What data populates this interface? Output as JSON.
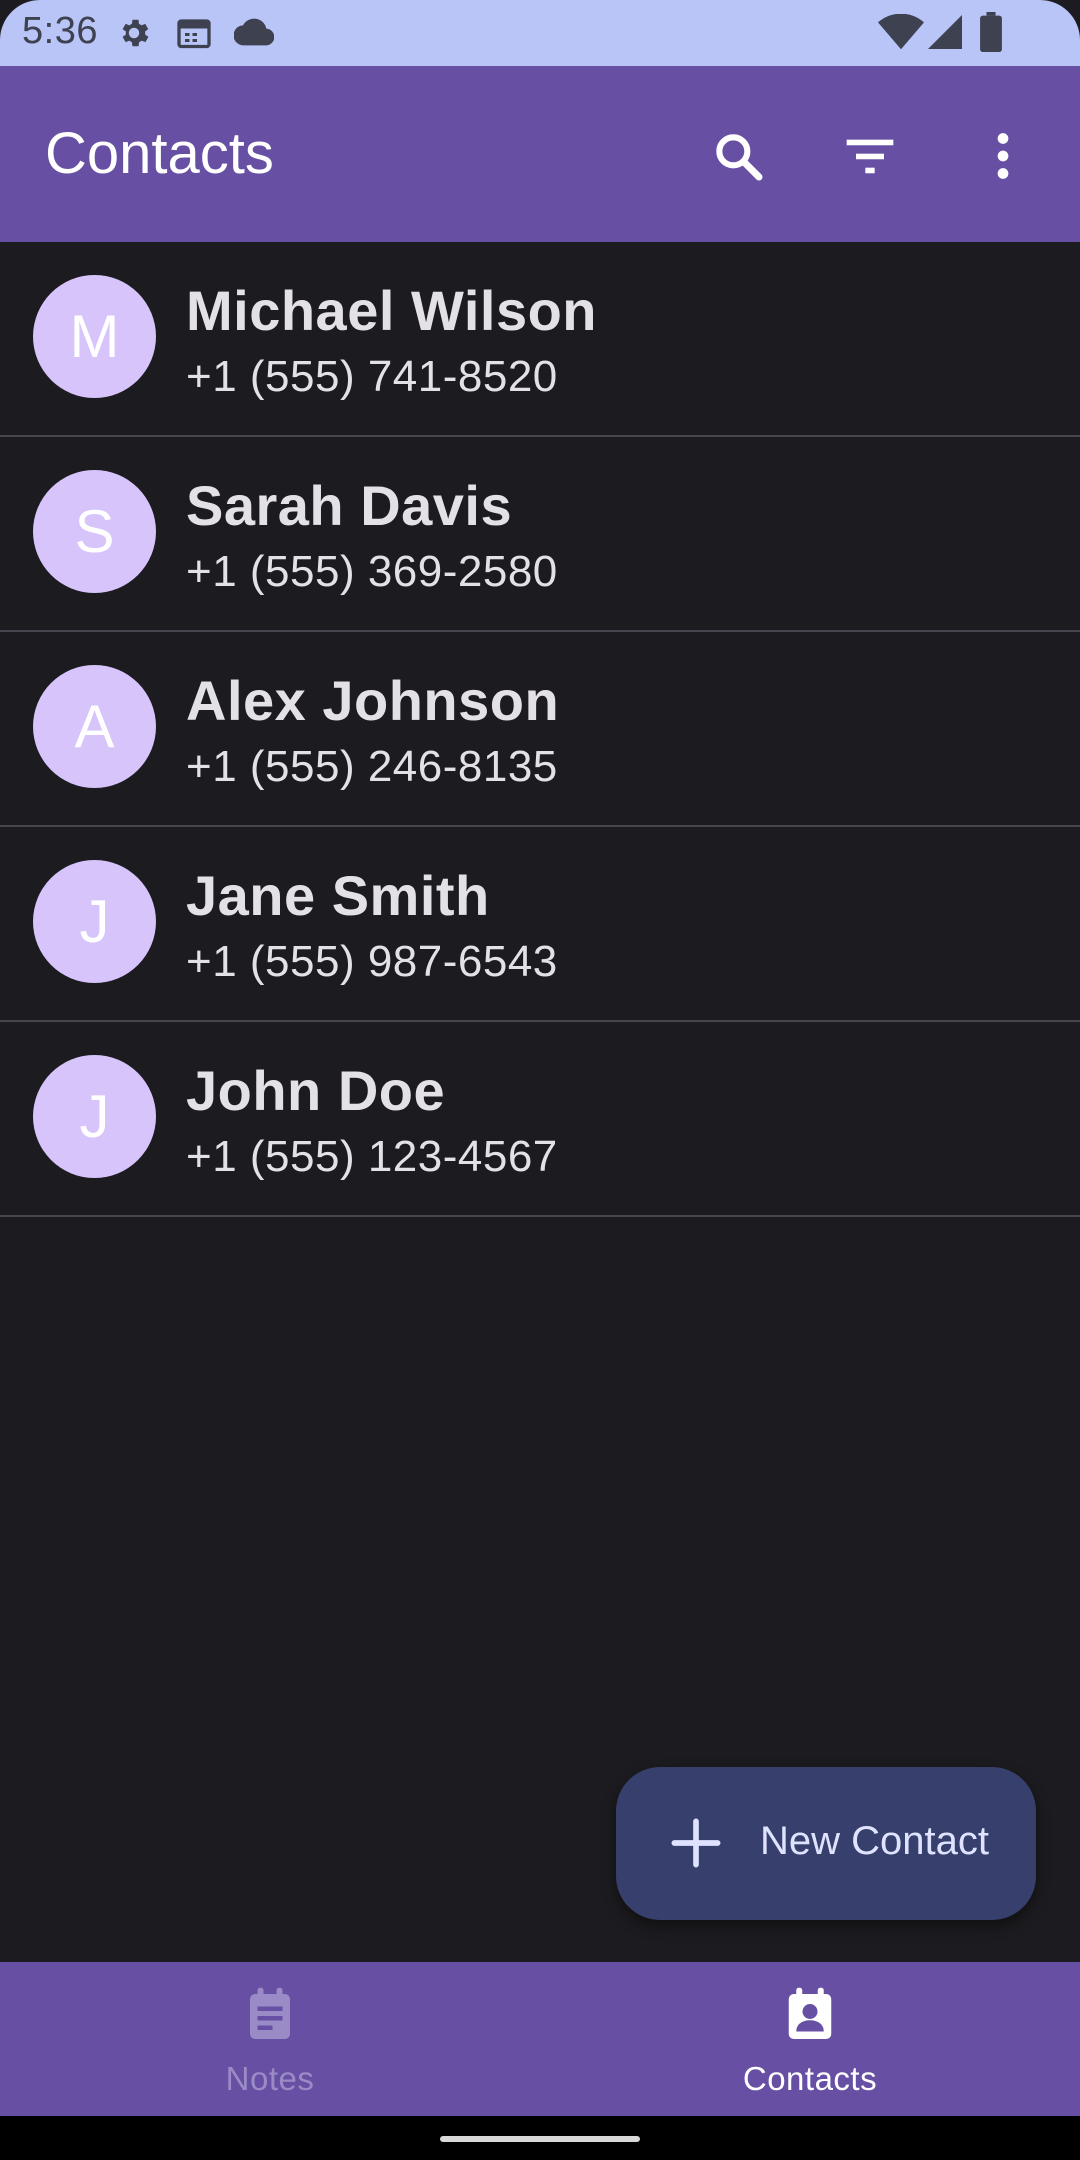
{
  "status_bar": {
    "time": "5:36",
    "left_icons": [
      "gear-icon",
      "calendar-icon",
      "cloud-icon"
    ],
    "right_icons": [
      "wifi-icon",
      "signal-icon",
      "battery-icon"
    ]
  },
  "app_bar": {
    "title": "Contacts",
    "actions": [
      "search-icon",
      "filter-icon",
      "more-vert-icon"
    ]
  },
  "contacts": [
    {
      "initial": "M",
      "name": "Michael Wilson",
      "phone": "+1 (555) 741-8520"
    },
    {
      "initial": "S",
      "name": "Sarah Davis",
      "phone": "+1 (555) 369-2580"
    },
    {
      "initial": "A",
      "name": "Alex Johnson",
      "phone": "+1 (555) 246-8135"
    },
    {
      "initial": "J",
      "name": "Jane Smith",
      "phone": "+1 (555) 987-6543"
    },
    {
      "initial": "J",
      "name": "John Doe",
      "phone": "+1 (555) 123-4567"
    }
  ],
  "fab": {
    "label": "New Contact",
    "icon": "plus-icon"
  },
  "bottom_nav": {
    "items": [
      {
        "label": "Notes",
        "icon": "notes-icon",
        "active": false
      },
      {
        "label": "Contacts",
        "icon": "contacts-icon",
        "active": true
      }
    ]
  },
  "colors": {
    "app_bar": "#6750a4",
    "status_bar": "#b9c4f7",
    "background": "#1c1b1f",
    "avatar": "#d6c4fb",
    "fab": "#37406c"
  }
}
